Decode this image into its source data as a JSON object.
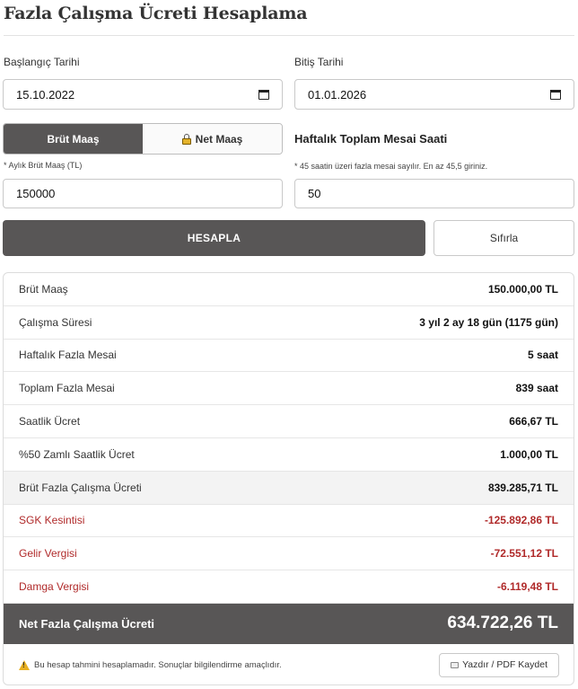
{
  "page": {
    "title": "Fazla Çalışma Ücreti Hesaplama"
  },
  "dates": {
    "start_label": "Başlangıç Tarihi",
    "start_value": "15.10.2022",
    "end_label": "Bitiş Tarihi",
    "end_value": "01.01.2026"
  },
  "salary": {
    "gross_tab": "Brüt Maaş",
    "net_tab": "Net Maaş",
    "active_tab": "gross",
    "hint": "* Aylık Brüt Maaş (TL)",
    "value": "150000"
  },
  "hours": {
    "label": "Haftalık Toplam Mesai Saati",
    "hint": "* 45 saatin üzeri fazla mesai sayılır. En az 45,5 giriniz.",
    "value": "50"
  },
  "actions": {
    "calculate": "HESAPLA",
    "reset": "Sıfırla"
  },
  "results": {
    "rows": [
      {
        "label": "Brüt Maaş",
        "value": "150.000,00 TL",
        "style": "normal"
      },
      {
        "label": "Çalışma Süresi",
        "value": "3 yıl 2 ay 18 gün (1175 gün)",
        "style": "normal"
      },
      {
        "label": "Haftalık Fazla Mesai",
        "value": "5 saat",
        "style": "normal"
      },
      {
        "label": "Toplam Fazla Mesai",
        "value": "839 saat",
        "style": "normal"
      },
      {
        "label": "Saatlik Ücret",
        "value": "666,67 TL",
        "style": "normal"
      },
      {
        "label": "%50 Zamlı Saatlik Ücret",
        "value": "1.000,00 TL",
        "style": "normal"
      },
      {
        "label": "Brüt Fazla Çalışma Ücreti",
        "value": "839.285,71 TL",
        "style": "shaded"
      },
      {
        "label": "SGK Kesintisi",
        "value": "-125.892,86 TL",
        "style": "red"
      },
      {
        "label": "Gelir Vergisi",
        "value": "-72.551,12 TL",
        "style": "red"
      },
      {
        "label": "Damga Vergisi",
        "value": "-6.119,48 TL",
        "style": "red"
      }
    ],
    "total_label": "Net Fazla Çalışma Ücreti",
    "total_value": "634.722,26 TL",
    "disclaimer": "Bu hesap tahmini hesaplamadır. Sonuçlar bilgilendirme amaçlıdır.",
    "print_label": "Yazdır / PDF Kaydet"
  },
  "colors": {
    "primary": "#585656",
    "deduction": "#b02a2a",
    "warning": "#e8b020"
  }
}
